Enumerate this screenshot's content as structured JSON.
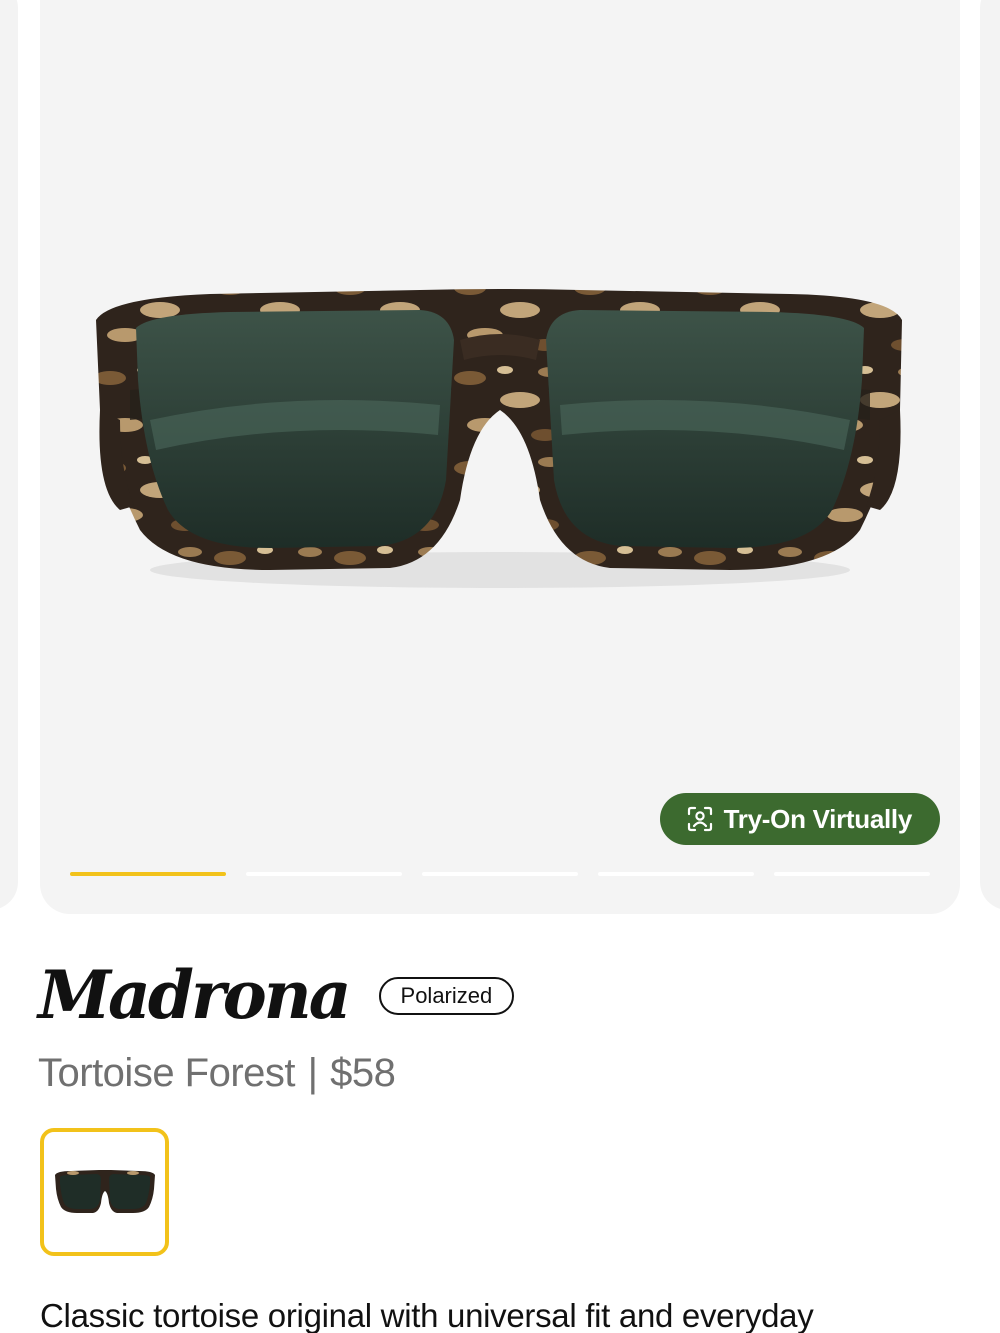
{
  "product": {
    "name": "Madrona",
    "badge": "Polarized",
    "color_name": "Tortoise Forest",
    "separator": "|",
    "price": "$58",
    "description": "Classic tortoise original with universal fit and everyday"
  },
  "gallery": {
    "try_on_label": "Try-On Virtually",
    "try_on_icon": "face-scan-icon",
    "slide_count": 5,
    "active_slide": 1
  },
  "colors": {
    "accent_yellow": "#f2c21a",
    "button_green": "#3c6a2f",
    "image_background": "#f4f4f4"
  }
}
